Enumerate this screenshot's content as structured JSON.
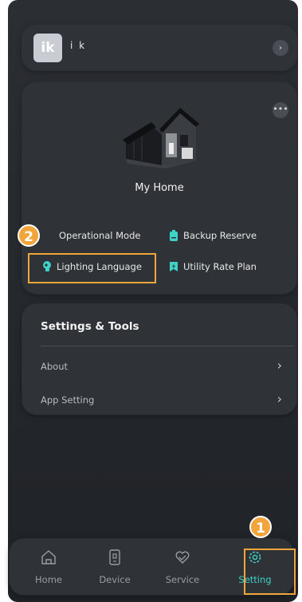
{
  "profile": {
    "avatar_text": "ik",
    "username": "i k",
    "arrow": "›"
  },
  "home": {
    "name": "My Home",
    "more": "•••",
    "features": [
      {
        "label": "Operational Mode",
        "icon": "operational-mode-icon"
      },
      {
        "label": "Backup Reserve",
        "icon": "battery-icon"
      },
      {
        "label": "Lighting Language",
        "icon": "lightbulb-icon"
      },
      {
        "label": "Utility Rate Plan",
        "icon": "bolt-bookmark-icon"
      }
    ]
  },
  "settings": {
    "title": "Settings & Tools",
    "items": [
      {
        "label": "About",
        "chevron": "›"
      },
      {
        "label": "App Setting",
        "chevron": "›"
      }
    ]
  },
  "nav": {
    "tabs": [
      {
        "label": "Home",
        "icon": "home-icon"
      },
      {
        "label": "Device",
        "icon": "device-icon"
      },
      {
        "label": "Service",
        "icon": "service-icon"
      },
      {
        "label": "Setting",
        "icon": "gear-icon",
        "active": true
      }
    ]
  },
  "annotations": {
    "step1": "1",
    "step2": "2"
  },
  "colors": {
    "accent": "#3fd2c7",
    "highlight": "#f0a73a",
    "background": "#2b2e33",
    "card": "#2f3237"
  }
}
